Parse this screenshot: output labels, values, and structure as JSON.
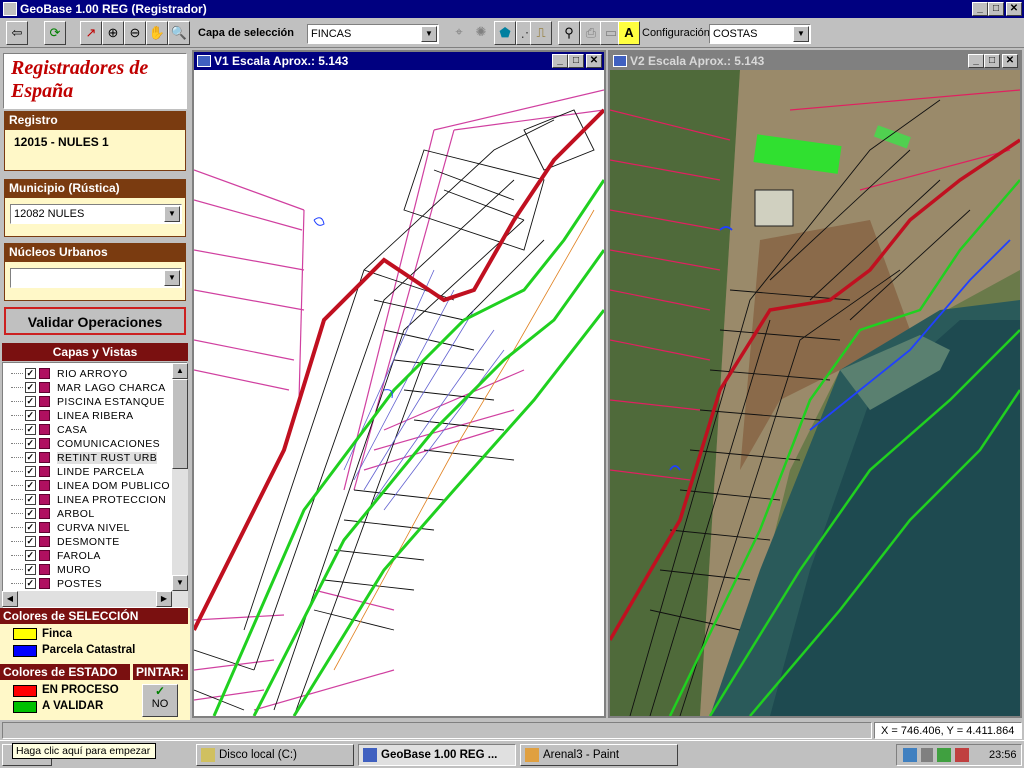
{
  "app": {
    "title": "GeoBase  1.00  REG  (Registrador)"
  },
  "toolbar": {
    "seleccion_label": "Capa de selección",
    "seleccion_value": "FINCAS",
    "config_label": "Configuración",
    "config_value": "COSTAS"
  },
  "sidebar": {
    "brand": "Registradores de España",
    "registro": {
      "header": "Registro",
      "value": "12015 - NULES 1"
    },
    "municipio": {
      "header": "Municipio (Rústica)",
      "value": "12082 NULES"
    },
    "nucleos": {
      "header": "Núcleos Urbanos",
      "value": ""
    },
    "validate_label": "Validar Operaciones",
    "layers_header": "Capas y Vistas",
    "layers": [
      "RIO ARROYO",
      "MAR LAGO CHARCA",
      "PISCINA ESTANQUE",
      "LINEA RIBERA",
      "CASA",
      "COMUNICACIONES",
      "RETINT RUST URB",
      "LINDE PARCELA",
      "LINEA DOM PUBLICO",
      "LINEA PROTECCION",
      "ARBOL",
      "CURVA NIVEL",
      "DESMONTE",
      "FAROLA",
      "MURO",
      "POSTES"
    ],
    "selected_layer_index": 6,
    "colores_seleccion": {
      "header": "Colores de SELECCIÓN",
      "items": [
        {
          "label": "Finca",
          "color": "#ffff00"
        },
        {
          "label": "Parcela Catastral",
          "color": "#0000ff"
        }
      ]
    },
    "colores_estado": {
      "header": "Colores de ESTADO",
      "items": [
        {
          "label": "EN PROCESO",
          "color": "#ff0000"
        },
        {
          "label": "A VALIDAR",
          "color": "#00c000"
        }
      ]
    },
    "pintar": {
      "header": "PINTAR:",
      "value": "NO"
    }
  },
  "views": [
    {
      "title": "V1 Escala Aprox.: 5.143",
      "active": true
    },
    {
      "title": "V2 Escala Aprox.: 5.143",
      "active": false
    }
  ],
  "status": {
    "coords": "X = 746.406, Y = 4.411.864"
  },
  "taskbar": {
    "tooltip": "Haga clic aquí para empezar",
    "tasks": [
      "Disco local (C:)",
      "GeoBase  1.00  REG ...",
      "Arenal3 - Paint"
    ],
    "clock": "23:56"
  },
  "colors": {
    "titlebar": "#000080",
    "brand": "#c00000",
    "section_header": "#7a3b10",
    "inactive_title": "#808080"
  }
}
